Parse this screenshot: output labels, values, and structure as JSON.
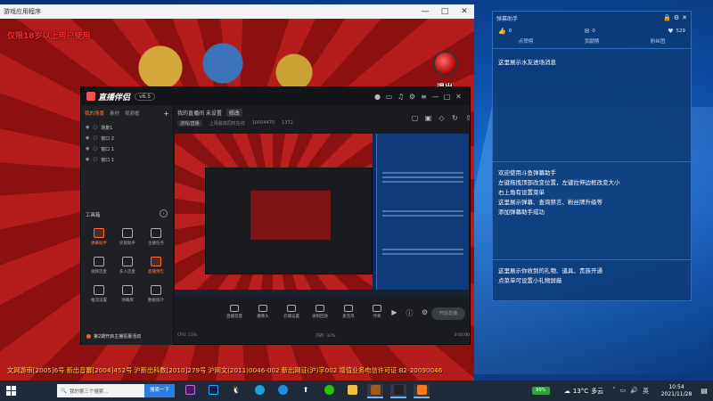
{
  "game_window": {
    "title": "游戏应用程序",
    "age_warning": "仅限18岁以上用户使用",
    "exit_label": "退出",
    "license_text": "文网游审[2005]6号  新出音審[2004]452号  沪新出科数[2010]279号  沪网文(2011)0046-002  新出网证(沪)字002  增值业务电信许可证 B2-20090046"
  },
  "stream_app": {
    "logo": "直播伴侣",
    "version": "v6.5",
    "left_tabs": [
      {
        "label": "我的场景",
        "active": true
      },
      {
        "label": "素材",
        "active": false
      },
      {
        "label": "视频框",
        "active": false
      }
    ],
    "scenes": [
      "场景1",
      "窗口 2",
      "窗口 1",
      "窗口 1"
    ],
    "tools_title": "工具箱",
    "tools": [
      {
        "label": "弹幕助手",
        "hot": true
      },
      {
        "label": "房管助手",
        "hot": false
      },
      {
        "label": "主播任务",
        "hot": false
      },
      {
        "label": "视频连麦",
        "hot": false
      },
      {
        "label": "多人连麦",
        "hot": false
      },
      {
        "label": "直播预告",
        "hot": true
      },
      {
        "label": "推流设置",
        "hot": false
      },
      {
        "label": "弹幕库",
        "hot": false
      },
      {
        "label": "数据统计",
        "hot": false
      }
    ],
    "notice": "第2期开启主播招募活动",
    "room_title": "我的直播间 未设置",
    "room_edit": "修改",
    "room_category": "游戏/直播",
    "room_meta": "上周最高同时在线",
    "room_id": "10004470",
    "room_likes": "1372",
    "bottom_buttons": [
      "直播音量",
      "摄像头",
      "云端设置",
      "录制回放",
      "麦克风",
      "伴奏"
    ],
    "start_button": "开始直播",
    "status_left": "CPU: 13%",
    "status_mid": "内存: 32%",
    "status_right": "0:00:00"
  },
  "danmu_panel": {
    "title": "弹幕助手",
    "stats": [
      {
        "symbol": "👍",
        "value": "0"
      },
      {
        "symbol": "✉",
        "value": "0"
      },
      {
        "symbol": "♥",
        "value": "529"
      }
    ],
    "subtabs": [
      "点赞榜",
      "贡献榜",
      "粉丝团"
    ],
    "section1": "这里展示水友进场消息",
    "section2": [
      "欢迎使用斗鱼弹幕助手",
      "左键拖拽顶部改变位置，左键拉伸边框改变大小",
      "右上角有设置菜单",
      "这里展示弹幕、查询禁言、粉丝牌升级等",
      "添加弹幕助手成功"
    ],
    "section3": [
      "这里展示你收到的礼物、道具、贵族开通",
      "点菜单可设置小礼物屏蔽"
    ]
  },
  "taskbar": {
    "search_placeholder": "我的第三个搜索...",
    "search_button": "搜索一下",
    "battery": "99%",
    "weather_temp": "13°C",
    "weather_desc": "多云",
    "ime": "英",
    "time": "10:54",
    "date": "2021/11/28"
  }
}
